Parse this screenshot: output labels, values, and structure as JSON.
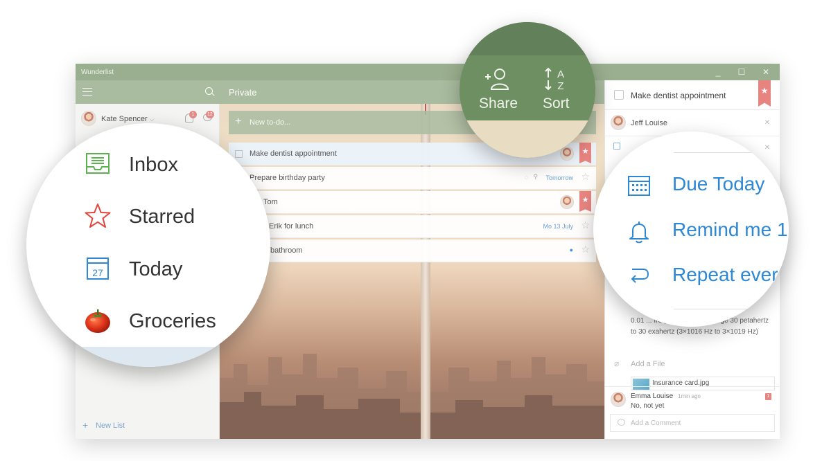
{
  "window": {
    "title": "Wunderlist",
    "controls": [
      "_",
      "☐",
      "✕"
    ]
  },
  "sidebar": {
    "user": {
      "name": "Kate Spencer",
      "caret": "⌵"
    },
    "notifications_count": "1",
    "messages_count": "12",
    "new_list_label": "New List",
    "new_list_plus": "+"
  },
  "main": {
    "list_title": "Private",
    "new_todo_placeholder": "New to-do...",
    "new_todo_plus": "+",
    "tasks": [
      {
        "title": "Make dentist appointment",
        "meta": "",
        "starred": true
      },
      {
        "title": "Prepare birthday party",
        "meta": "Tomorrow",
        "starred": false
      },
      {
        "title": "Tom",
        "meta": "",
        "starred": true
      },
      {
        "title": "Erik for lunch",
        "meta": "Mo 13 July",
        "starred": false
      },
      {
        "title": "bathroom",
        "meta": "",
        "starred": false
      }
    ]
  },
  "detail": {
    "title": "Make dentist appointment",
    "assignee": "Jeff Louise",
    "note": "0.01 ... frequencies in the range 30 petahertz to 30 exahertz (3×1016 Hz to 3×1019 Hz)",
    "add_file_label": "Add a File",
    "file_name": "Insurance card.jpg",
    "comment": {
      "author": "Emma Louise",
      "time": "1min ago",
      "text": "No, not yet",
      "badge": "1"
    },
    "add_comment_placeholder": "Add a Comment"
  },
  "zoom_left": {
    "items": [
      {
        "label": "Inbox",
        "icon": "inbox-icon"
      },
      {
        "label": "Starred",
        "icon": "star-icon"
      },
      {
        "label": "Today",
        "icon": "calendar-today-icon",
        "day": "27"
      },
      {
        "label": "Groceries",
        "icon": "tomato-icon"
      }
    ]
  },
  "zoom_top": {
    "share_label": "Share",
    "sort_label": "Sort"
  },
  "zoom_right": {
    "due_label": "Due Today",
    "remind_label": "Remind me 1",
    "repeat_label": "Repeat ever"
  },
  "colors": {
    "header_green": "#a9bc9f",
    "accent_blue": "#2e87d3",
    "star_red": "#e88480"
  }
}
